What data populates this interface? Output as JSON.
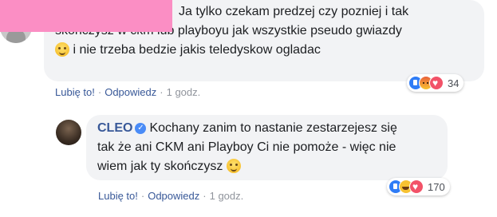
{
  "comment1": {
    "lines": [
      "Ja tylko czekam predzej czy pozniej i tak",
      "skonczysz w ckm lub playboyu jak wszystkie pseudo gwiazdy",
      "i nie trzeba bedzie jakis teledyskow ogladac"
    ],
    "emoji": "smile-emoji",
    "actions": {
      "like": "Lubię to!",
      "reply": "Odpowiedz",
      "time": "1 godz."
    },
    "reactions": {
      "icons": [
        "like",
        "angry",
        "love"
      ],
      "count": "34"
    }
  },
  "reply": {
    "author": "CLEO",
    "lines": [
      "Kochany zanim to nastanie zestarzejesz się",
      "tak że ani CKM ani Playboy Ci nie pomoże - więc nie",
      "wiem jak ty skończysz"
    ],
    "emoji": "smile-emoji",
    "actions": {
      "like": "Lubię to!",
      "reply": "Odpowiedz",
      "time": "1 godz."
    },
    "reactions": {
      "icons": [
        "like",
        "haha",
        "love"
      ],
      "count": "170"
    }
  },
  "colors": {
    "link": "#385898",
    "bubble": "#f2f3f5",
    "redaction": "#fb8ec4"
  }
}
